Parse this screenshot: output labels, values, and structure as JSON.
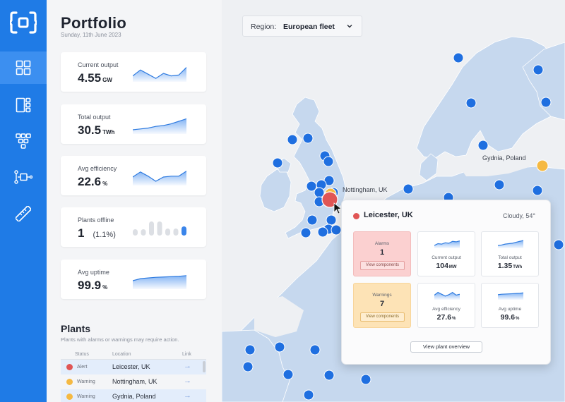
{
  "colors": {
    "brand": "#1f7be6",
    "alert": "#e05555",
    "warning": "#f5b942",
    "plant_dot": "#1f6fe0",
    "land": "#c6d8ee",
    "sea": "#eef0f3"
  },
  "sidebar": {
    "logo_icon": "bracket-logo-icon",
    "items": [
      {
        "name": "dashboard-grid",
        "icon": "grid-icon",
        "active": true
      },
      {
        "name": "layout",
        "icon": "layout-panel-icon",
        "active": false
      },
      {
        "name": "hierarchy",
        "icon": "hierarchy-icon",
        "active": false
      },
      {
        "name": "workflow",
        "icon": "workflow-icon",
        "active": false
      },
      {
        "name": "measure",
        "icon": "ruler-icon",
        "active": false
      }
    ]
  },
  "header": {
    "title": "Portfolio",
    "date": "Sunday, 11th June 2023"
  },
  "kpis": [
    {
      "label": "Current output",
      "value": "4.55",
      "unit": "GW",
      "spark": [
        0.35,
        0.7,
        0.45,
        0.2,
        0.5,
        0.35,
        0.4,
        0.85
      ]
    },
    {
      "label": "Total output",
      "value": "30.5",
      "unit": "TWh",
      "spark": [
        0.25,
        0.3,
        0.35,
        0.45,
        0.5,
        0.6,
        0.75,
        0.9
      ]
    },
    {
      "label": "Avg efficiency",
      "value": "22.6",
      "unit": "%",
      "spark": [
        0.5,
        0.8,
        0.55,
        0.25,
        0.5,
        0.55,
        0.55,
        0.85
      ]
    },
    {
      "label": "Plants offline",
      "value": "1",
      "unit": "(1.1%)",
      "bars": [
        0.45,
        0.45,
        1.0,
        1.0,
        0.5,
        0.5,
        0.65
      ],
      "highlight_index": 6
    },
    {
      "label": "Avg uptime",
      "value": "99.9",
      "unit": "%",
      "spark": [
        0.5,
        0.62,
        0.66,
        0.7,
        0.72,
        0.74,
        0.76,
        0.8
      ]
    }
  ],
  "plants": {
    "title": "Plants",
    "subtitle": "Plants with alarms or warnings may require action.",
    "columns": [
      "Status",
      "Location",
      "Link"
    ],
    "rows": [
      {
        "status": "Alert",
        "location": "Leicester, UK",
        "level": "alert",
        "selected": true
      },
      {
        "status": "Warning",
        "location": "Nottingham, UK",
        "level": "warning",
        "selected": false
      },
      {
        "status": "Warning",
        "location": "Gydnia, Poland",
        "level": "warning",
        "selected": true
      }
    ],
    "link_glyph": "→"
  },
  "map": {
    "region_label": "Region:",
    "region_value": "European fleet",
    "labels": [
      {
        "text": "Nottingham, UK"
      },
      {
        "text": "Gydnia, Poland"
      }
    ]
  },
  "popup": {
    "name": "Leicester, UK",
    "weather": "Cloudy, 54°",
    "alarms": {
      "label": "Alarms",
      "value": "1",
      "button": "View components"
    },
    "warnings": {
      "label": "Warnings",
      "value": "7",
      "button": "View components"
    },
    "metrics": [
      {
        "label": "Current output",
        "value": "104",
        "unit": "MW",
        "spark": [
          0.3,
          0.5,
          0.45,
          0.6,
          0.55,
          0.75,
          0.7,
          0.8
        ]
      },
      {
        "label": "Total output",
        "value": "1.35",
        "unit": "TWh",
        "spark": [
          0.3,
          0.35,
          0.45,
          0.5,
          0.55,
          0.65,
          0.75,
          0.85
        ]
      },
      {
        "label": "Avg efficiency",
        "value": "27.6",
        "unit": "%",
        "spark": [
          0.5,
          0.8,
          0.6,
          0.4,
          0.55,
          0.8,
          0.5,
          0.6
        ]
      },
      {
        "label": "Avg uptime",
        "value": "99.6",
        "unit": "%",
        "spark": [
          0.55,
          0.6,
          0.62,
          0.64,
          0.66,
          0.68,
          0.7,
          0.75
        ]
      }
    ],
    "overview_button": "View plant overview"
  }
}
